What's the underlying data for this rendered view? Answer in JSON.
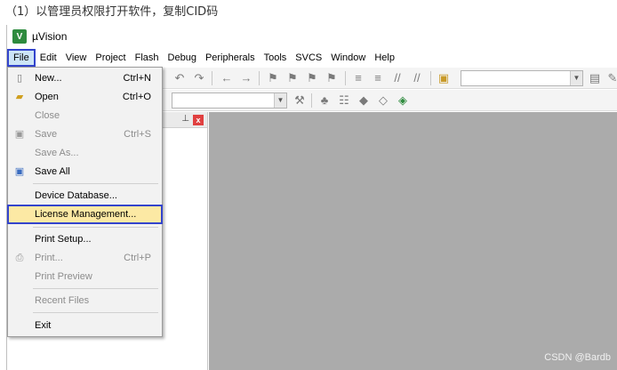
{
  "caption": "（1）以管理员权限打开软件，复制CID码",
  "app": {
    "title": "µVision",
    "icon_letter": "V"
  },
  "menu": [
    "File",
    "Edit",
    "View",
    "Project",
    "Flash",
    "Debug",
    "Peripherals",
    "Tools",
    "SVCS",
    "Window",
    "Help"
  ],
  "file_menu": {
    "new": {
      "label": "New...",
      "shortcut": "Ctrl+N"
    },
    "open": {
      "label": "Open",
      "shortcut": "Ctrl+O"
    },
    "close": {
      "label": "Close"
    },
    "save": {
      "label": "Save",
      "shortcut": "Ctrl+S"
    },
    "save_as": {
      "label": "Save As..."
    },
    "save_all": {
      "label": "Save All"
    },
    "device_database": {
      "label": "Device Database..."
    },
    "license_management": {
      "label": "License Management..."
    },
    "print_setup": {
      "label": "Print Setup..."
    },
    "print": {
      "label": "Print...",
      "shortcut": "Ctrl+P"
    },
    "print_preview": {
      "label": "Print Preview"
    },
    "recent_files": {
      "label": "Recent Files"
    },
    "exit": {
      "label": "Exit"
    }
  },
  "panel": {
    "pin": "⊥",
    "close": "x"
  },
  "watermark": "CSDN @Bardb",
  "icons": [
    "new-file-icon",
    "open-folder-icon",
    "save-icon",
    "save-all-icon",
    "print-icon"
  ],
  "colors": {
    "highlight_border": "#3344cc",
    "editor_bg": "#ababab"
  }
}
